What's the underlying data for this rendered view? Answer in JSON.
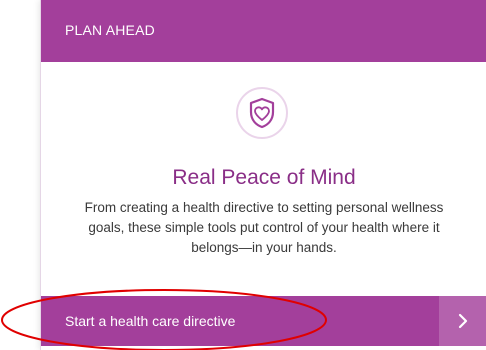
{
  "card": {
    "header": "PLAN AHEAD",
    "emblem_icon": "shield-heart-icon",
    "title": "Real Peace of Mind",
    "description": "From creating a health directive to setting personal wellness goals, these simple tools put control of your health where it belongs—in your hands.",
    "cta_label": "Start a health care directive",
    "cta_icon": "chevron-right-icon"
  },
  "colors": {
    "brand": "#a33f9b",
    "brand_light": "#b462ad",
    "headline": "#8a2e87",
    "annotation": "#e00000"
  }
}
